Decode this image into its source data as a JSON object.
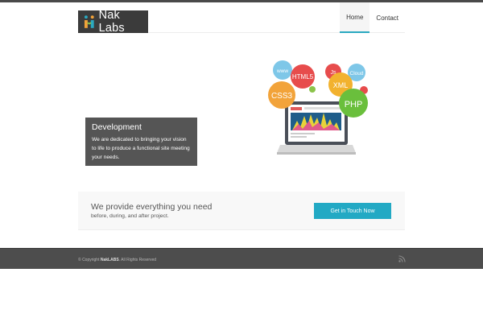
{
  "header": {
    "logo_text": "Nak Labs",
    "nav": [
      {
        "label": "Home",
        "active": true
      },
      {
        "label": "Contact",
        "active": false
      }
    ]
  },
  "hero": {
    "title": "Development",
    "text": "We are dedicated to bringing your vision to life to produce a functional site meeting your needs."
  },
  "illustration": {
    "bubbles": [
      "www",
      "HTML5",
      "Js",
      "Cloud",
      "CSS3",
      "XML",
      "PHP"
    ]
  },
  "cta": {
    "title": "We provide everything you need",
    "subtitle": "before, during, and after project.",
    "button_label": "Get in Touch Now"
  },
  "footer": {
    "copyright_prefix": "© Copyright",
    "copyright_brand": "NakLABS",
    "copyright_suffix": ". All Rights Reserved",
    "icon": "rss-icon"
  },
  "colors": {
    "accent": "#22a9c4",
    "topbar": "#4a4a4a",
    "footer": "#4d4d4d",
    "hero_box": "#555555"
  }
}
